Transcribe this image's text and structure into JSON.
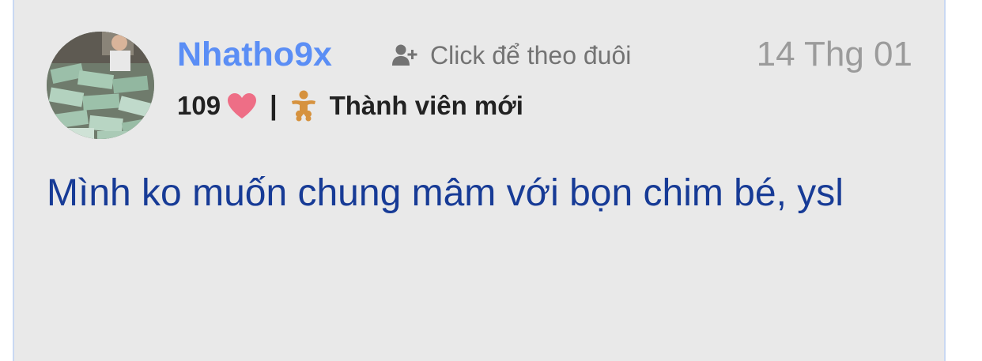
{
  "post": {
    "author": {
      "name": "Nhatho9x",
      "avatar_icon": "user-avatar-photo"
    },
    "follow": {
      "label": "Click để theo đuôi",
      "icon": "user-plus-icon"
    },
    "date": "14 Thg 01",
    "likes": {
      "count": "109",
      "icon": "heart-icon",
      "color": "#ee6e86"
    },
    "separator": "|",
    "rank": {
      "label": "Thành viên mới",
      "icon": "baby-icon",
      "color": "#d6923e"
    },
    "content": "Mình ko muốn chung mâm với bọn chim bé, ysl"
  },
  "colors": {
    "username": "#5b8ef5",
    "content_text": "#173b96",
    "card_background": "#e9e9e9",
    "card_border": "#c9d8f2"
  }
}
